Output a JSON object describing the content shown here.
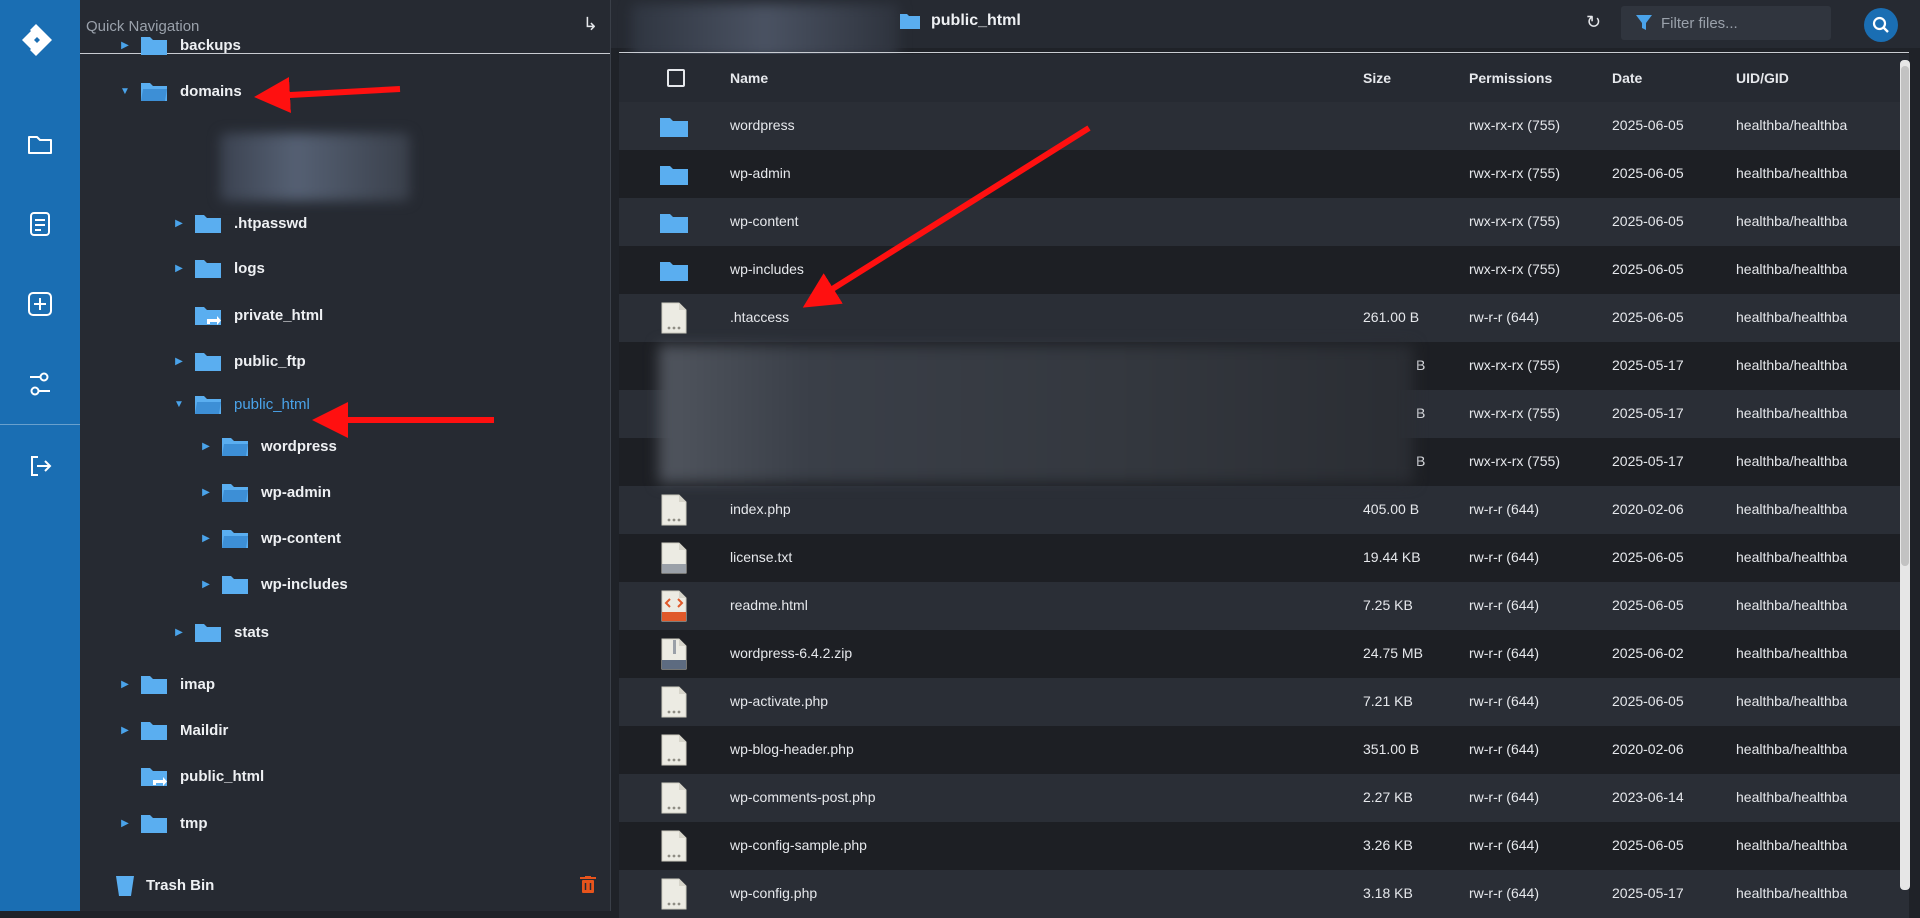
{
  "colors": {
    "brand": "#1a6eb3",
    "accent": "#4aa3ea",
    "folder": "#5aaef0"
  },
  "tree": {
    "header": "Quick Navigation",
    "items": [
      {
        "label": "backups",
        "level": 1,
        "expand": "collapsed",
        "kind": "folder"
      },
      {
        "label": "domains",
        "level": 1,
        "expand": "expanded",
        "kind": "folder-open"
      },
      {
        "label": ".htpasswd",
        "level": 2,
        "expand": "collapsed",
        "kind": "folder"
      },
      {
        "label": "logs",
        "level": 2,
        "expand": "collapsed",
        "kind": "folder"
      },
      {
        "label": "private_html",
        "level": 2,
        "expand": "none",
        "kind": "folder-link"
      },
      {
        "label": "public_ftp",
        "level": 2,
        "expand": "collapsed",
        "kind": "folder"
      },
      {
        "label": "public_html",
        "level": 2,
        "expand": "expanded",
        "kind": "folder-open",
        "active": true
      },
      {
        "label": "wordpress",
        "level": 3,
        "expand": "collapsed",
        "kind": "folder-open"
      },
      {
        "label": "wp-admin",
        "level": 3,
        "expand": "collapsed",
        "kind": "folder-open"
      },
      {
        "label": "wp-content",
        "level": 3,
        "expand": "collapsed",
        "kind": "folder-open"
      },
      {
        "label": "wp-includes",
        "level": 3,
        "expand": "collapsed",
        "kind": "folder"
      },
      {
        "label": "stats",
        "level": 2,
        "expand": "collapsed",
        "kind": "folder"
      },
      {
        "label": "imap",
        "level": 1,
        "expand": "collapsed",
        "kind": "folder"
      },
      {
        "label": "Maildir",
        "level": 1,
        "expand": "collapsed",
        "kind": "folder"
      },
      {
        "label": "public_html",
        "level": 1,
        "expand": "none",
        "kind": "folder-link"
      },
      {
        "label": "tmp",
        "level": 1,
        "expand": "collapsed",
        "kind": "folder"
      }
    ],
    "trash_label": "Trash Bin"
  },
  "topbar": {
    "current_folder": "public_html",
    "filter_placeholder": "Filter files..."
  },
  "table": {
    "headers": {
      "name": "Name",
      "size": "Size",
      "permissions": "Permissions",
      "date": "Date",
      "uid": "UID/GID"
    },
    "rows": [
      {
        "icon": "folder",
        "name": "wordpress",
        "size": "",
        "perm": "rwx-rx-rx (755)",
        "date": "2025-06-05",
        "uid": "healthba/healthba"
      },
      {
        "icon": "folder",
        "name": "wp-admin",
        "size": "",
        "perm": "rwx-rx-rx (755)",
        "date": "2025-06-05",
        "uid": "healthba/healthba"
      },
      {
        "icon": "folder",
        "name": "wp-content",
        "size": "",
        "perm": "rwx-rx-rx (755)",
        "date": "2025-06-05",
        "uid": "healthba/healthba"
      },
      {
        "icon": "folder",
        "name": "wp-includes",
        "size": "",
        "perm": "rwx-rx-rx (755)",
        "date": "2025-06-05",
        "uid": "healthba/healthba"
      },
      {
        "icon": "file",
        "name": ".htaccess",
        "size": "261.00 B",
        "perm": "rw-r-r (644)",
        "date": "2025-06-05",
        "uid": "healthba/healthba"
      },
      {
        "icon": "hidden",
        "name": "",
        "size": "B",
        "perm": "rwx-rx-rx (755)",
        "date": "2025-05-17",
        "uid": "healthba/healthba"
      },
      {
        "icon": "hidden",
        "name": "",
        "size": "B",
        "perm": "rwx-rx-rx (755)",
        "date": "2025-05-17",
        "uid": "healthba/healthba"
      },
      {
        "icon": "hidden",
        "name": "",
        "size": "B",
        "perm": "rwx-rx-rx (755)",
        "date": "2025-05-17",
        "uid": "healthba/healthba"
      },
      {
        "icon": "file",
        "name": "index.php",
        "size": "405.00 B",
        "perm": "rw-r-r (644)",
        "date": "2020-02-06",
        "uid": "healthba/healthba"
      },
      {
        "icon": "txt",
        "name": "license.txt",
        "size": "19.44 KB",
        "perm": "rw-r-r (644)",
        "date": "2025-06-05",
        "uid": "healthba/healthba"
      },
      {
        "icon": "html",
        "name": "readme.html",
        "size": "7.25 KB",
        "perm": "rw-r-r (644)",
        "date": "2025-06-05",
        "uid": "healthba/healthba"
      },
      {
        "icon": "zip",
        "name": "wordpress-6.4.2.zip",
        "size": "24.75 MB",
        "perm": "rw-r-r (644)",
        "date": "2025-06-02",
        "uid": "healthba/healthba"
      },
      {
        "icon": "file",
        "name": "wp-activate.php",
        "size": "7.21 KB",
        "perm": "rw-r-r (644)",
        "date": "2025-06-05",
        "uid": "healthba/healthba"
      },
      {
        "icon": "file",
        "name": "wp-blog-header.php",
        "size": "351.00 B",
        "perm": "rw-r-r (644)",
        "date": "2020-02-06",
        "uid": "healthba/healthba"
      },
      {
        "icon": "file",
        "name": "wp-comments-post.php",
        "size": "2.27 KB",
        "perm": "rw-r-r (644)",
        "date": "2023-06-14",
        "uid": "healthba/healthba"
      },
      {
        "icon": "file",
        "name": "wp-config-sample.php",
        "size": "3.26 KB",
        "perm": "rw-r-r (644)",
        "date": "2025-06-05",
        "uid": "healthba/healthba"
      },
      {
        "icon": "file",
        "name": "wp-config.php",
        "size": "3.18 KB",
        "perm": "rw-r-r (644)",
        "date": "2025-05-17",
        "uid": "healthba/healthba"
      }
    ]
  }
}
